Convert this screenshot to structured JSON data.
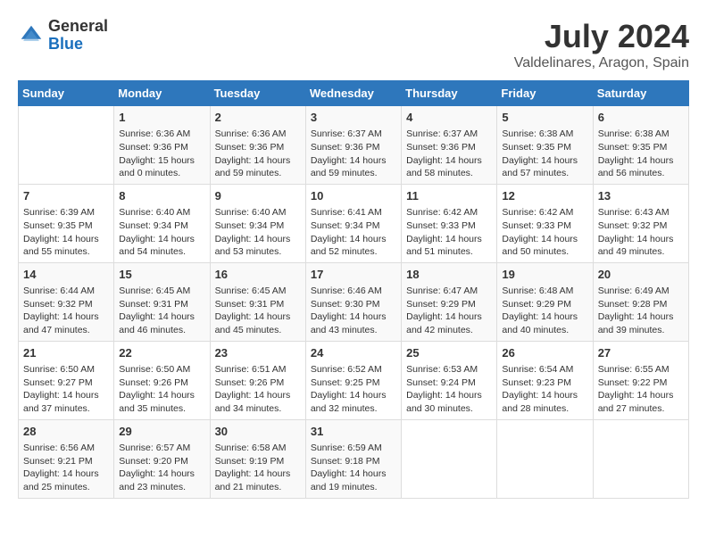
{
  "header": {
    "logo_general": "General",
    "logo_blue": "Blue",
    "month_title": "July 2024",
    "location": "Valdelinares, Aragon, Spain"
  },
  "days_of_week": [
    "Sunday",
    "Monday",
    "Tuesday",
    "Wednesday",
    "Thursday",
    "Friday",
    "Saturday"
  ],
  "weeks": [
    [
      {
        "day": "",
        "info": ""
      },
      {
        "day": "1",
        "info": "Sunrise: 6:36 AM\nSunset: 9:36 PM\nDaylight: 15 hours\nand 0 minutes."
      },
      {
        "day": "2",
        "info": "Sunrise: 6:36 AM\nSunset: 9:36 PM\nDaylight: 14 hours\nand 59 minutes."
      },
      {
        "day": "3",
        "info": "Sunrise: 6:37 AM\nSunset: 9:36 PM\nDaylight: 14 hours\nand 59 minutes."
      },
      {
        "day": "4",
        "info": "Sunrise: 6:37 AM\nSunset: 9:36 PM\nDaylight: 14 hours\nand 58 minutes."
      },
      {
        "day": "5",
        "info": "Sunrise: 6:38 AM\nSunset: 9:35 PM\nDaylight: 14 hours\nand 57 minutes."
      },
      {
        "day": "6",
        "info": "Sunrise: 6:38 AM\nSunset: 9:35 PM\nDaylight: 14 hours\nand 56 minutes."
      }
    ],
    [
      {
        "day": "7",
        "info": "Sunrise: 6:39 AM\nSunset: 9:35 PM\nDaylight: 14 hours\nand 55 minutes."
      },
      {
        "day": "8",
        "info": "Sunrise: 6:40 AM\nSunset: 9:34 PM\nDaylight: 14 hours\nand 54 minutes."
      },
      {
        "day": "9",
        "info": "Sunrise: 6:40 AM\nSunset: 9:34 PM\nDaylight: 14 hours\nand 53 minutes."
      },
      {
        "day": "10",
        "info": "Sunrise: 6:41 AM\nSunset: 9:34 PM\nDaylight: 14 hours\nand 52 minutes."
      },
      {
        "day": "11",
        "info": "Sunrise: 6:42 AM\nSunset: 9:33 PM\nDaylight: 14 hours\nand 51 minutes."
      },
      {
        "day": "12",
        "info": "Sunrise: 6:42 AM\nSunset: 9:33 PM\nDaylight: 14 hours\nand 50 minutes."
      },
      {
        "day": "13",
        "info": "Sunrise: 6:43 AM\nSunset: 9:32 PM\nDaylight: 14 hours\nand 49 minutes."
      }
    ],
    [
      {
        "day": "14",
        "info": "Sunrise: 6:44 AM\nSunset: 9:32 PM\nDaylight: 14 hours\nand 47 minutes."
      },
      {
        "day": "15",
        "info": "Sunrise: 6:45 AM\nSunset: 9:31 PM\nDaylight: 14 hours\nand 46 minutes."
      },
      {
        "day": "16",
        "info": "Sunrise: 6:45 AM\nSunset: 9:31 PM\nDaylight: 14 hours\nand 45 minutes."
      },
      {
        "day": "17",
        "info": "Sunrise: 6:46 AM\nSunset: 9:30 PM\nDaylight: 14 hours\nand 43 minutes."
      },
      {
        "day": "18",
        "info": "Sunrise: 6:47 AM\nSunset: 9:29 PM\nDaylight: 14 hours\nand 42 minutes."
      },
      {
        "day": "19",
        "info": "Sunrise: 6:48 AM\nSunset: 9:29 PM\nDaylight: 14 hours\nand 40 minutes."
      },
      {
        "day": "20",
        "info": "Sunrise: 6:49 AM\nSunset: 9:28 PM\nDaylight: 14 hours\nand 39 minutes."
      }
    ],
    [
      {
        "day": "21",
        "info": "Sunrise: 6:50 AM\nSunset: 9:27 PM\nDaylight: 14 hours\nand 37 minutes."
      },
      {
        "day": "22",
        "info": "Sunrise: 6:50 AM\nSunset: 9:26 PM\nDaylight: 14 hours\nand 35 minutes."
      },
      {
        "day": "23",
        "info": "Sunrise: 6:51 AM\nSunset: 9:26 PM\nDaylight: 14 hours\nand 34 minutes."
      },
      {
        "day": "24",
        "info": "Sunrise: 6:52 AM\nSunset: 9:25 PM\nDaylight: 14 hours\nand 32 minutes."
      },
      {
        "day": "25",
        "info": "Sunrise: 6:53 AM\nSunset: 9:24 PM\nDaylight: 14 hours\nand 30 minutes."
      },
      {
        "day": "26",
        "info": "Sunrise: 6:54 AM\nSunset: 9:23 PM\nDaylight: 14 hours\nand 28 minutes."
      },
      {
        "day": "27",
        "info": "Sunrise: 6:55 AM\nSunset: 9:22 PM\nDaylight: 14 hours\nand 27 minutes."
      }
    ],
    [
      {
        "day": "28",
        "info": "Sunrise: 6:56 AM\nSunset: 9:21 PM\nDaylight: 14 hours\nand 25 minutes."
      },
      {
        "day": "29",
        "info": "Sunrise: 6:57 AM\nSunset: 9:20 PM\nDaylight: 14 hours\nand 23 minutes."
      },
      {
        "day": "30",
        "info": "Sunrise: 6:58 AM\nSunset: 9:19 PM\nDaylight: 14 hours\nand 21 minutes."
      },
      {
        "day": "31",
        "info": "Sunrise: 6:59 AM\nSunset: 9:18 PM\nDaylight: 14 hours\nand 19 minutes."
      },
      {
        "day": "",
        "info": ""
      },
      {
        "day": "",
        "info": ""
      },
      {
        "day": "",
        "info": ""
      }
    ]
  ]
}
